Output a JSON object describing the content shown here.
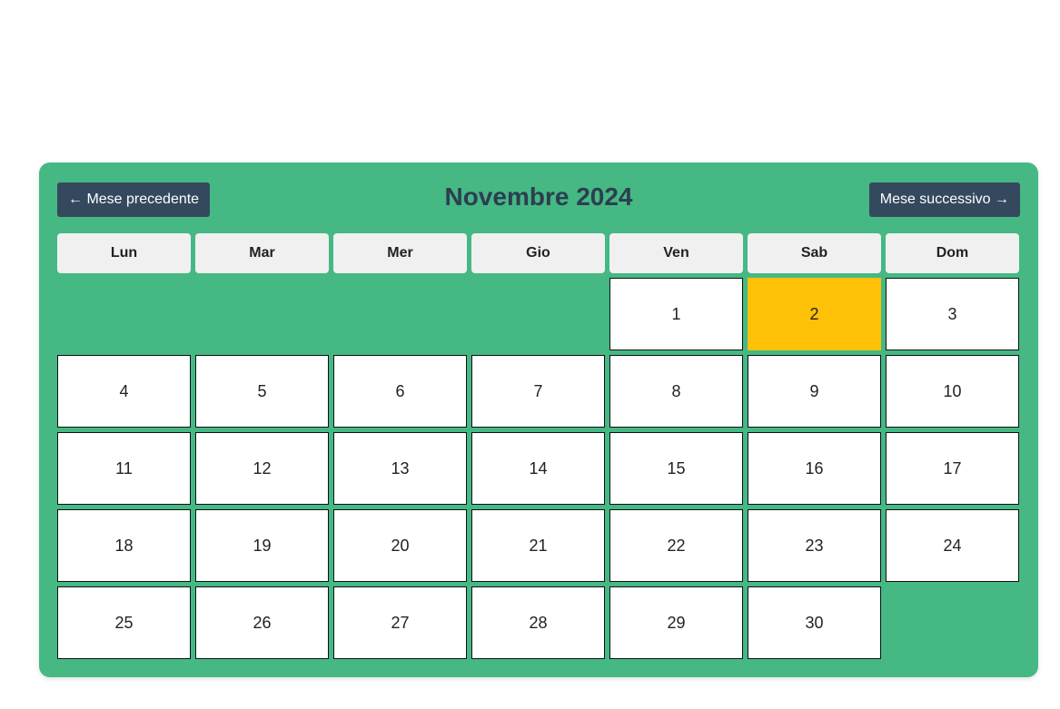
{
  "colors": {
    "calendar_bg": "#45b884",
    "button_bg": "#34495e",
    "title_color": "#2c3e50",
    "weekday_bg": "#f0f0f0",
    "today_bg": "#ffc107"
  },
  "header": {
    "prev_label": "← Mese precedente",
    "title": "Novembre 2024",
    "next_label": "Mese successivo →"
  },
  "weekdays": [
    "Lun",
    "Mar",
    "Mer",
    "Gio",
    "Ven",
    "Sab",
    "Dom"
  ],
  "month": {
    "first_weekday_index": 4,
    "days": [
      "1",
      "2",
      "3",
      "4",
      "5",
      "6",
      "7",
      "8",
      "9",
      "10",
      "11",
      "12",
      "13",
      "14",
      "15",
      "16",
      "17",
      "18",
      "19",
      "20",
      "21",
      "22",
      "23",
      "24",
      "25",
      "26",
      "27",
      "28",
      "29",
      "30"
    ],
    "highlighted_day": "2"
  }
}
